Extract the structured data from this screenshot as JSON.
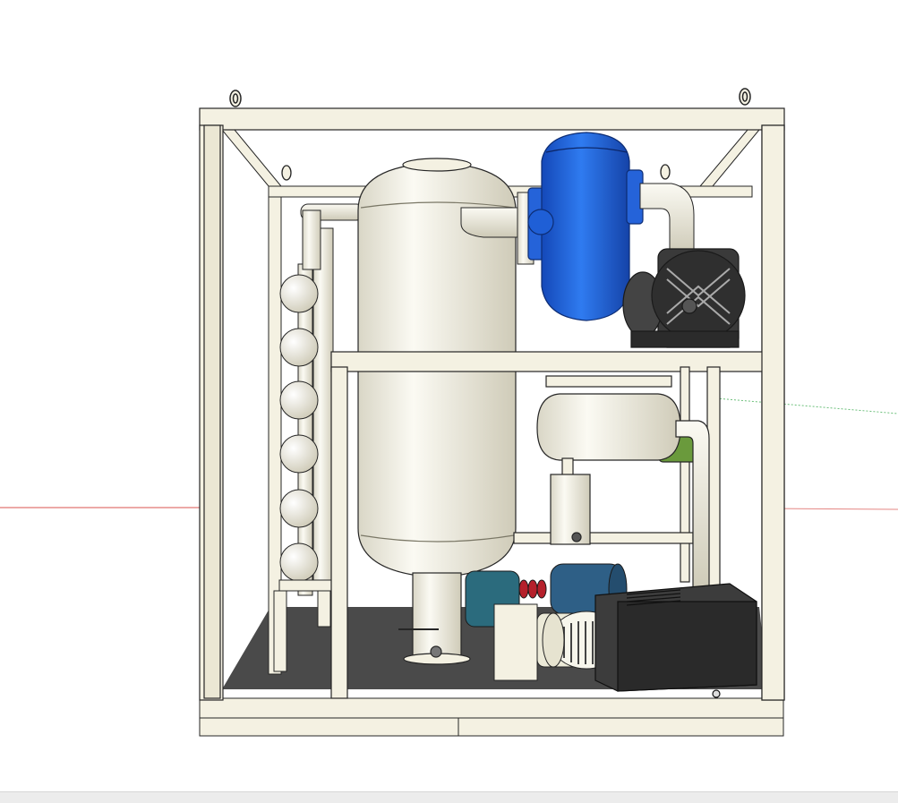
{
  "scene": {
    "subject": "",
    "components": [
      {
        "id": "frame",
        "label": ""
      },
      {
        "id": "vacuum-tank",
        "label": ""
      },
      {
        "id": "heater-pipes",
        "label": ""
      },
      {
        "id": "roots-pump",
        "label": ""
      },
      {
        "id": "blower-motor",
        "label": ""
      },
      {
        "id": "condenser-tank",
        "label": ""
      },
      {
        "id": "oil-pump",
        "label": ""
      },
      {
        "id": "vacuum-pump",
        "label": ""
      }
    ]
  },
  "colors": {
    "background": "#ffffff",
    "frame": "#f4f1e2",
    "frame_stroke": "#262626",
    "tank": "#f2f0e4",
    "blue_pump": "#1f5fd6",
    "motor_dark": "#3a3a3a",
    "teal_motor": "#2b6b7d",
    "red_coupling": "#b5202b",
    "green_pipe": "#6a9a3c",
    "floor": "#4a4a4a",
    "axis_red": "#d9534f",
    "axis_green": "#6bbf7a",
    "statusbar": "#ececec"
  }
}
